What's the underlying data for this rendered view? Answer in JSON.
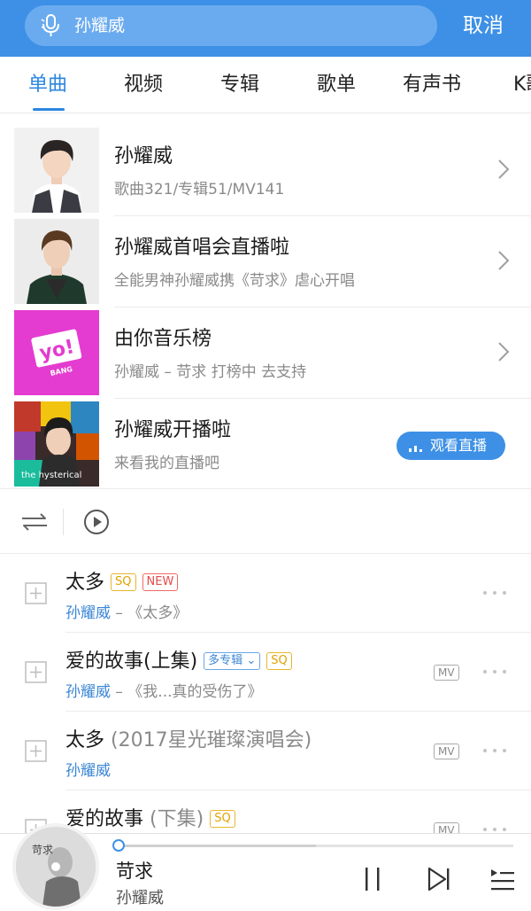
{
  "search": {
    "query": "孙耀威",
    "cancel_label": "取消"
  },
  "tabs": [
    {
      "label": "单曲",
      "active": true
    },
    {
      "label": "视频"
    },
    {
      "label": "专辑"
    },
    {
      "label": "歌单"
    },
    {
      "label": "有声书"
    },
    {
      "label": "K歌"
    }
  ],
  "cards": [
    {
      "title": "孙耀威",
      "subtitle": "歌曲321/专辑51/MV141"
    },
    {
      "title": "孙耀威首唱会直播啦",
      "subtitle": "全能男神孙耀威携《苛求》虐心开唱"
    },
    {
      "title": "由你音乐榜",
      "subtitle": "孙耀威 – 苛求 打榜中 去支持",
      "logo_text": "yo!",
      "logo_sub": "BANG"
    },
    {
      "title": "孙耀威开播啦",
      "subtitle": "来看我的直播吧",
      "button_label": "观看直播",
      "poster_text": "the hysterical"
    }
  ],
  "songs": [
    {
      "title": "太多",
      "extra": "",
      "tags": {
        "sq": "SQ",
        "new": "NEW"
      },
      "artist": "孙耀威",
      "album": " – 《太多》"
    },
    {
      "title": "爱的故事(上集)",
      "extra": "",
      "tags": {
        "multi": "多专辑",
        "sq": "SQ"
      },
      "artist": "孙耀威",
      "album": " – 《我...真的受伤了》",
      "mv": "MV"
    },
    {
      "title": "太多",
      "extra": " (2017星光璀璨演唱会)",
      "artist": "孙耀威",
      "album": "",
      "mv": "MV"
    },
    {
      "title": "爱的故事",
      "extra": " (下集)",
      "tags": {
        "sq": "SQ"
      },
      "artist": "",
      "album": "",
      "mv": "MV"
    }
  ],
  "player": {
    "title": "苛求",
    "artist": "孙耀威",
    "progress": 0.5,
    "disc_text": "苛求"
  },
  "colors": {
    "brand_blue": "#3d90e6",
    "link_blue": "#3a86d4",
    "sq_gold": "#e0a300",
    "new_red": "#e84a4a",
    "yo_magenta": "#e43bd0"
  }
}
